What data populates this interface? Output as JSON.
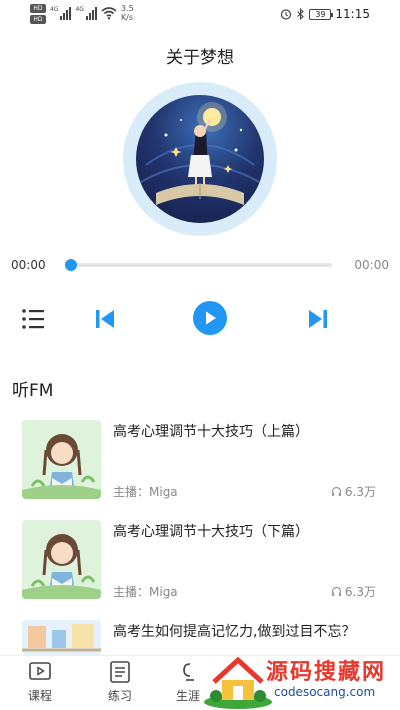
{
  "status_bar": {
    "hd1": "HD",
    "hd2": "HD",
    "sig1_label": "4G",
    "sig2_label": "4G",
    "speed_value": "3.5",
    "speed_unit": "K/s",
    "battery": "39",
    "time": "11:15"
  },
  "player": {
    "title": "关于梦想",
    "time_current": "00:00",
    "time_total": "00:00",
    "progress": 0,
    "accent_color": "#2196f3"
  },
  "section": {
    "title": "听FM"
  },
  "items": [
    {
      "title": "高考心理调节十大技巧（上篇）",
      "host": "主播：Miga",
      "plays": "6.3万"
    },
    {
      "title": "高考心理调节十大技巧（下篇）",
      "host": "主播：Miga",
      "plays": "6.3万"
    },
    {
      "title": "高考生如何提高记忆力,做到过目不忘？",
      "host": "",
      "plays": ""
    }
  ],
  "bottom_nav": [
    {
      "label": "课程",
      "icon": "play-box-icon"
    },
    {
      "label": "练习",
      "icon": "list-box-icon"
    },
    {
      "label": "生涯",
      "icon": "career-icon"
    }
  ],
  "watermark": {
    "text": "源码搜藏网",
    "url": "codesocang.com"
  }
}
